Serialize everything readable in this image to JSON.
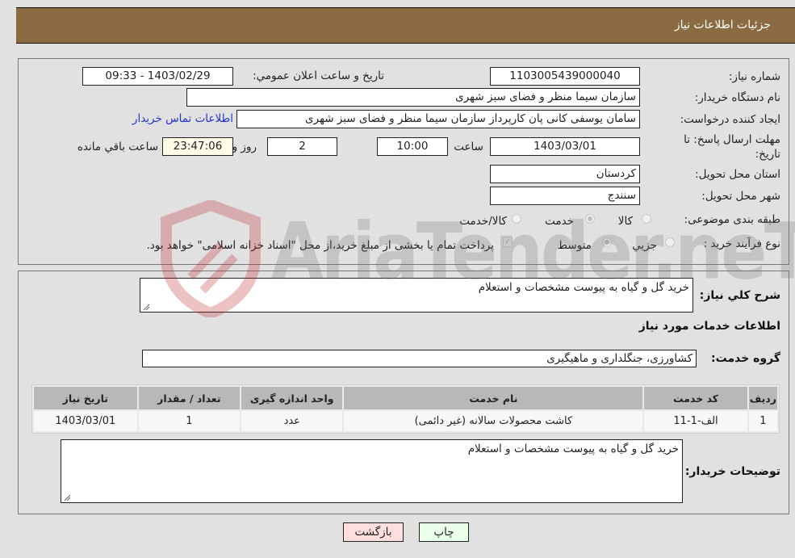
{
  "header": {
    "title": "جزئیات اطلاعات نیاز"
  },
  "details": {
    "need_number_label": "شماره نیاز:",
    "need_number": "1103005439000040",
    "announce_label": "تاریخ و ساعت اعلان عمومي:",
    "announce_value": "1403/02/29 - 09:33",
    "buyer_org_label": "نام دستگاه خریدار:",
    "buyer_org": "سازمان سیما  منظر و فضای سبز شهری",
    "creator_label": "ایجاد کننده درخواست:",
    "creator": "سامان یوسفی کانی پان کارپرداز سازمان سیما  منظر و فضای سبز شهری",
    "contact_link": "اطلاعات تماس خریدار",
    "deadline_label_line1": "مهلت ارسال پاسخ: تا",
    "deadline_label_line2": "تاریخ:",
    "deadline_date": "1403/03/01",
    "time_label": "ساعت",
    "deadline_time": "10:00",
    "days_value": "2",
    "days_label": "روز و",
    "remaining_time": "23:47:06",
    "remaining_label": "ساعت باقي مانده",
    "province_label": "استان محل تحویل:",
    "province": "کردستان",
    "city_label": "شهر محل تحویل:",
    "city": "سنندج",
    "category_label": "طبقه بندی موضوعی:",
    "category_options": [
      {
        "label": "کالا",
        "checked": false
      },
      {
        "label": "خدمت",
        "checked": true
      },
      {
        "label": "کالا/خدمت",
        "checked": false
      }
    ],
    "process_label": "نوع فرآیند خرید :",
    "process_options": [
      {
        "label": "جزیي",
        "checked": false
      },
      {
        "label": "متوسط",
        "checked": true
      }
    ],
    "treasury_checkbox_checked": true,
    "treasury_text": "پرداخت تمام یا بخشی از مبلغ خرید،از محل \"اسناد خزانه اسلامی\" خواهد بود."
  },
  "services": {
    "summary_label": "شرح کلي نیاز:",
    "summary_text": "خرید گل و گیاه به پیوست مشخصات و استعلام",
    "section_title": "اطلاعات خدمات مورد نیاز",
    "group_label": "گروه خدمت:",
    "group_value": "کشاورزی، جنگلداری و ماهیگیری",
    "table": {
      "headers": [
        "ردیف",
        "کد خدمت",
        "نام خدمت",
        "واحد اندازه گیری",
        "تعداد / مقدار",
        "تاریخ نیاز"
      ],
      "rows": [
        [
          "1",
          "الف-1-11",
          "کاشت محصولات سالانه (غیر دائمی)",
          "عدد",
          "1",
          "1403/03/01"
        ]
      ]
    },
    "buyer_notes_label": "توضیحات خریدار:",
    "buyer_notes_text": "خرید گل و گیاه به پیوست مشخصات و استعلام"
  },
  "buttons": {
    "print": "چاپ",
    "back": "بازگشت"
  },
  "watermark": {
    "text": "AriaTender.neT"
  }
}
